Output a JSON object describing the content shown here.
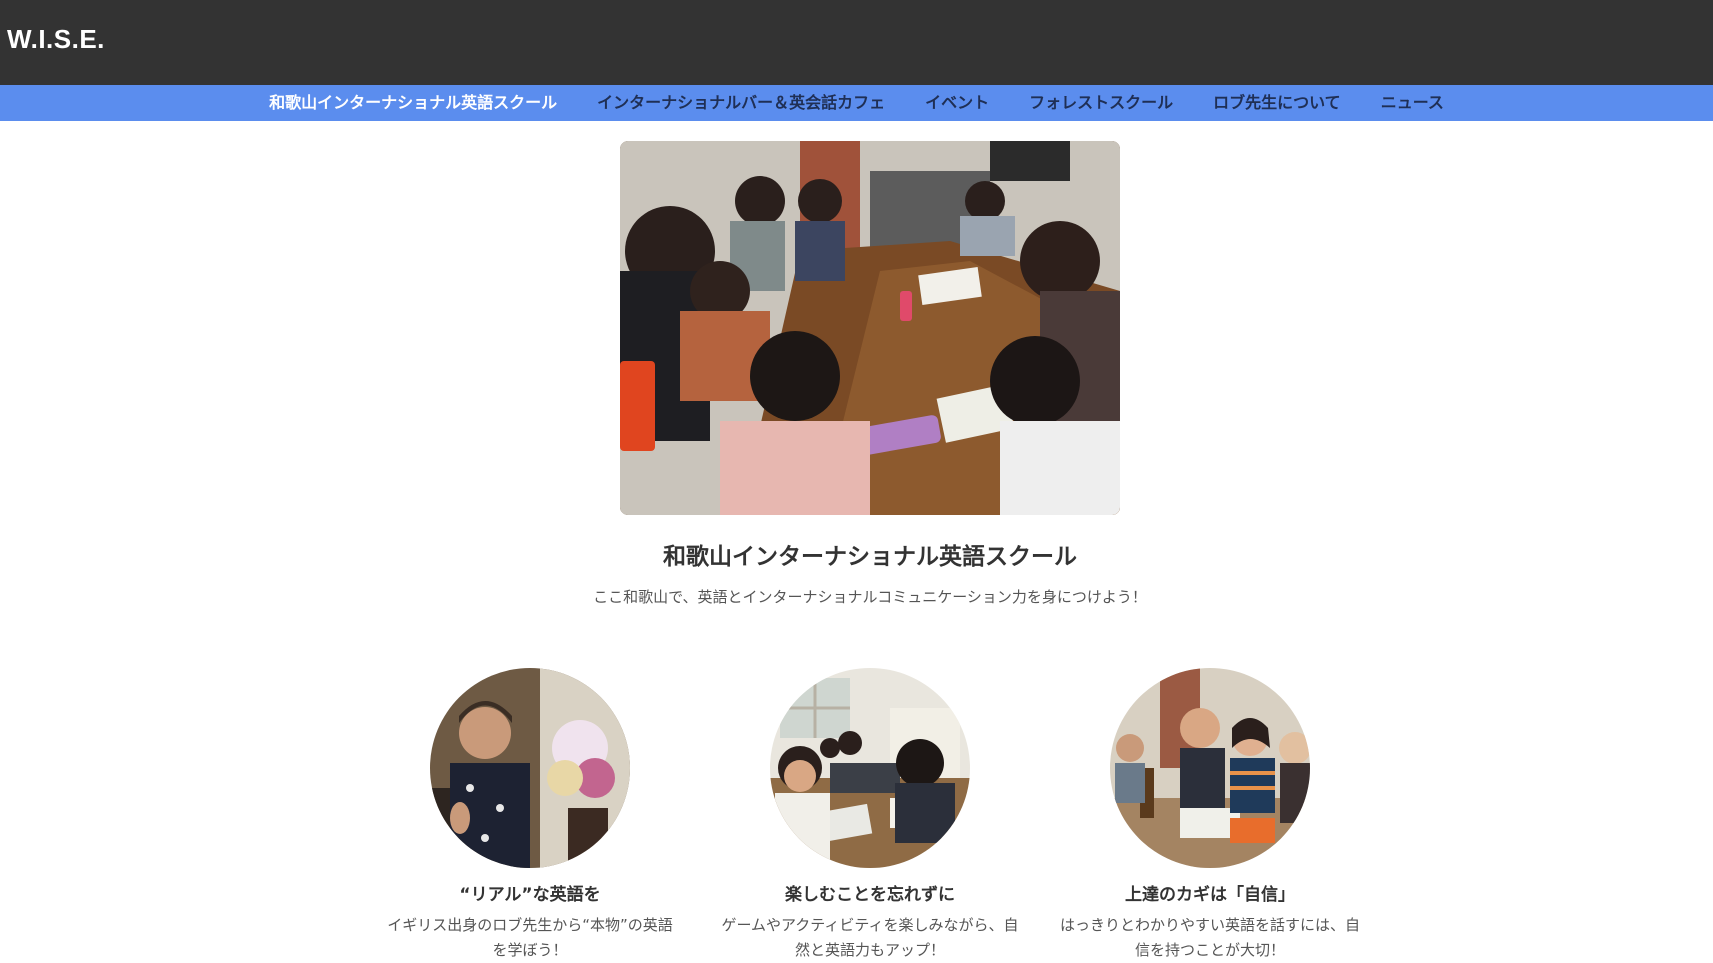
{
  "header": {
    "logo": "W.I.S.E."
  },
  "nav": {
    "items": [
      {
        "label": "和歌山インターナショナル英語スクール",
        "active": true
      },
      {
        "label": "インターナショナルバー＆英会話カフェ",
        "active": false
      },
      {
        "label": "イベント",
        "active": false
      },
      {
        "label": "フォレストスクール",
        "active": false
      },
      {
        "label": "ロブ先生について",
        "active": false
      },
      {
        "label": "ニュース",
        "active": false
      }
    ]
  },
  "hero": {
    "title": "和歌山インターナショナル英語スクール",
    "subtitle": "ここ和歌山で、英語とインターナショナルコミュニケーション力を身につけよう！"
  },
  "features": [
    {
      "title": "“リアル”な英語を",
      "text": "イギリス出身のロブ先生から“本物”の英語を学ぼう！"
    },
    {
      "title": "楽しむことを忘れずに",
      "text": "ゲームやアクティビティを楽しみながら、自然と英語力もアップ！"
    },
    {
      "title": "上達のカギは「自信」",
      "text": "はっきりとわかりやすい英語を話すには、自信を持つことが大切！"
    }
  ],
  "colors": {
    "topbar": "#333333",
    "navbar": "#5b8dee",
    "nav_active_text": "#ffffff",
    "nav_text": "#1f2f55"
  }
}
